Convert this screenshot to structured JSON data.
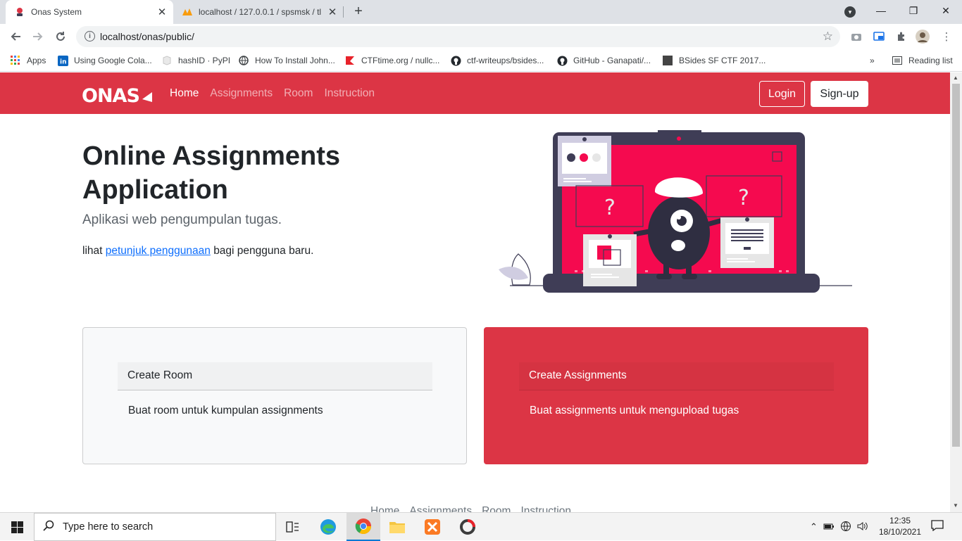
{
  "browser": {
    "tabs": [
      {
        "title": "Onas System",
        "active": true
      },
      {
        "title": "localhost / 127.0.0.1 / spsmsk / tl",
        "active": false
      }
    ],
    "address": "localhost/onas/public/",
    "bookmarks": [
      {
        "label": "Apps",
        "icon": "apps-grid-icon"
      },
      {
        "label": "Using Google Cola...",
        "icon": "linkedin-icon"
      },
      {
        "label": "hashID · PyPI",
        "icon": "pypi-icon"
      },
      {
        "label": "How To Install John...",
        "icon": "globe-icon"
      },
      {
        "label": "CTFtime.org / nullc...",
        "icon": "ctftime-icon"
      },
      {
        "label": "ctf-writeups/bsides...",
        "icon": "github-icon"
      },
      {
        "label": "GitHub - Ganapati/...",
        "icon": "github-icon"
      },
      {
        "label": "BSides SF CTF 2017...",
        "icon": "page-icon"
      }
    ],
    "more_bookmarks": "»",
    "reading_list": "Reading list"
  },
  "site": {
    "logo_text": "ONAS",
    "nav": [
      "Home",
      "Assignments",
      "Room",
      "Instruction"
    ],
    "login": "Login",
    "signup": "Sign-up",
    "hero": {
      "title": "Online Assignments Application",
      "subtitle": "Aplikasi web pengumpulan tugas.",
      "hint_prefix": "lihat",
      "hint_link": "petunjuk penggunaan",
      "hint_suffix": "bagi pengguna baru."
    },
    "cards": [
      {
        "header": "Create Room",
        "body": "Buat room untuk kumpulan assignments"
      },
      {
        "header": "Create Assignments",
        "body": "Buat assignments untuk mengupload tugas"
      }
    ],
    "footer_links": [
      "Home",
      "Assignments",
      "Room",
      "Instruction"
    ],
    "colors": {
      "brand": "#dc3545",
      "illustration_accent": "#f50a4f",
      "illustration_dark": "#3f3d56"
    }
  },
  "taskbar": {
    "search_placeholder": "Type here to search",
    "time": "12:35",
    "date": "18/10/2021"
  }
}
